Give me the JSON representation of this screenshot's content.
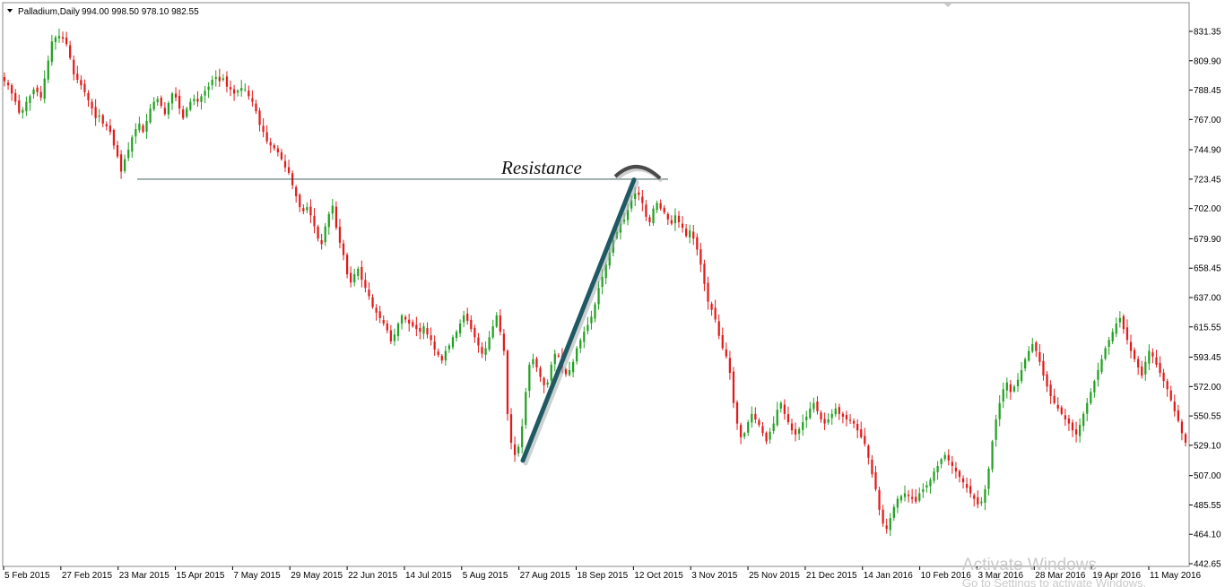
{
  "header": {
    "symbol_label": "Palladium,Daily",
    "ohlc_label": "994.00 998.50 978.10 982.55"
  },
  "colors": {
    "bull": "#22a022",
    "bear": "#e31a1a",
    "trendline": "#1f5a64",
    "resistance_line": "#2a4a4a",
    "arc": "#4a4a4a"
  },
  "annotation": {
    "label": "Resistance",
    "resistance_level": 723.45,
    "trendline_from": {
      "date": "2015-08-25",
      "price": 518
    },
    "trendline_to": {
      "date": "2015-10-12",
      "price": 723
    }
  },
  "watermark": {
    "line1": "Activate Windows",
    "line2": "Go to Settings to activate Windows."
  },
  "chart_data": {
    "type": "candlestick",
    "title": "Palladium,Daily",
    "xlabel": "",
    "ylabel": "",
    "ylim": [
      442.65,
      839.0
    ],
    "y_ticks": [
      "831.35",
      "809.90",
      "788.45",
      "767.00",
      "744.90",
      "723.45",
      "702.00",
      "679.90",
      "658.45",
      "637.00",
      "615.55",
      "593.45",
      "572.00",
      "550.55",
      "529.10",
      "507.00",
      "485.55",
      "464.10",
      "442.65"
    ],
    "x_ticks": [
      "5 Feb 2015",
      "27 Feb 2015",
      "23 Mar 2015",
      "15 Apr 2015",
      "7 May 2015",
      "29 May 2015",
      "22 Jun 2015",
      "14 Jul 2015",
      "5 Aug 2015",
      "27 Aug 2015",
      "18 Sep 2015",
      "12 Oct 2015",
      "3 Nov 2015",
      "25 Nov 2015",
      "21 Dec 2015",
      "14 Jan 2016",
      "10 Feb 2016",
      "3 Mar 2016",
      "28 Mar 2016",
      "19 Apr 2016",
      "11 May 2016"
    ],
    "grid": false,
    "legend": "none",
    "closes": [
      795,
      792,
      786,
      780,
      772,
      774,
      780,
      784,
      789,
      787,
      783,
      797,
      810,
      824,
      827,
      828,
      826,
      822,
      812,
      800,
      796,
      792,
      787,
      781,
      775,
      768,
      770,
      764,
      762,
      758,
      748,
      740,
      729,
      738,
      745,
      754,
      760,
      764,
      758,
      766,
      775,
      780,
      782,
      777,
      771,
      779,
      786,
      783,
      775,
      768,
      775,
      780,
      782,
      780,
      784,
      788,
      791,
      796,
      798,
      795,
      797,
      791,
      789,
      786,
      788,
      790,
      789,
      784,
      780,
      773,
      763,
      758,
      751,
      748,
      746,
      743,
      738,
      732,
      728,
      719,
      711,
      703,
      700,
      703,
      697,
      689,
      680,
      676,
      689,
      698,
      704,
      688,
      677,
      668,
      654,
      648,
      654,
      658,
      650,
      644,
      638,
      630,
      626,
      622,
      618,
      613,
      605,
      610,
      618,
      624,
      621,
      618,
      616,
      614,
      612,
      616,
      610,
      606,
      599,
      595,
      591,
      598,
      602,
      608,
      612,
      618,
      624,
      620,
      614,
      608,
      602,
      596,
      600,
      608,
      616,
      624,
      612,
      598,
      552,
      531,
      522,
      528,
      543,
      568,
      588,
      592,
      586,
      579,
      573,
      575,
      588,
      596,
      594,
      586,
      581,
      584,
      590,
      600,
      606,
      612,
      617,
      623,
      632,
      644,
      652,
      661,
      670,
      679,
      685,
      691,
      694,
      701,
      708,
      713,
      712,
      706,
      696,
      692,
      702,
      706,
      702,
      699,
      694,
      691,
      697,
      692,
      688,
      682,
      686,
      680,
      672,
      661,
      647,
      634,
      628,
      621,
      609,
      600,
      594,
      582,
      560,
      545,
      535,
      538,
      546,
      552,
      548,
      544,
      538,
      532,
      539,
      545,
      555,
      560,
      552,
      546,
      540,
      537,
      541,
      546,
      550,
      556,
      560,
      554,
      548,
      545,
      548,
      552,
      556,
      552,
      550,
      548,
      547,
      545,
      540,
      535,
      530,
      520,
      508,
      497,
      482,
      472,
      468,
      476,
      484,
      490,
      492,
      494,
      492,
      490,
      488,
      494,
      497,
      500,
      504,
      510,
      514,
      519,
      522,
      518,
      514,
      510,
      506,
      502,
      498,
      494,
      490,
      486,
      488,
      497,
      512,
      532,
      548,
      560,
      570,
      575,
      568,
      572,
      577,
      584,
      592,
      598,
      603,
      598,
      590,
      580,
      572,
      565,
      560,
      556,
      552,
      548,
      545,
      540,
      537,
      544,
      552,
      560,
      568,
      576,
      584,
      592,
      600,
      606,
      612,
      618,
      622,
      614,
      606,
      598,
      592,
      586,
      580,
      590,
      598,
      594,
      588,
      582,
      576,
      570,
      562,
      554,
      547,
      538,
      531
    ]
  }
}
